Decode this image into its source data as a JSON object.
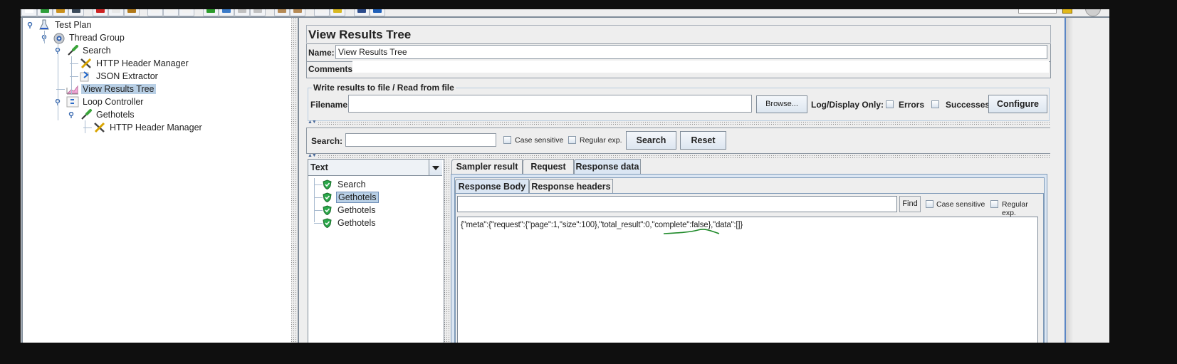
{
  "toolbar": {
    "buttons": [
      "new-icon",
      "templates-icon",
      "open-icon",
      "save-icon",
      "cut-icon",
      "copy-icon",
      "paste-icon",
      "expand-icon",
      "collapse-icon",
      "toggle-icon",
      "start-icon",
      "start-no-pauses-icon",
      "stop-icon",
      "shutdown-icon",
      "clear-icon",
      "clear-all-icon",
      "search-icon",
      "reset-search-icon",
      "function-helper-icon",
      "help-icon"
    ],
    "colors": [
      "#ffffff",
      "#2e9e3a",
      "#c98f1a",
      "#3a4a5a",
      "#cc2222",
      "#e8e8e8",
      "#b07818",
      "#f2f2f2",
      "#f2f2f2",
      "#f2f2f2",
      "#2a9a2a",
      "#3a7ac8",
      "#c0c0c0",
      "#c0c0c0",
      "#b58a55",
      "#b58a55",
      "#f2f2f2",
      "#d8b820",
      "#2a4a8a",
      "#1e5fb8"
    ]
  },
  "test_tree": {
    "items": [
      {
        "label": "Test Plan",
        "icon": "test-plan-flask-icon",
        "level": 0,
        "expandable": true
      },
      {
        "label": "Thread Group",
        "icon": "thread-group-gear-icon",
        "level": 1,
        "expandable": true
      },
      {
        "label": "Search",
        "icon": "http-sampler-pipette-icon",
        "level": 2,
        "expandable": true
      },
      {
        "label": "HTTP Header Manager",
        "icon": "config-tools-icon",
        "level": 3,
        "expandable": false
      },
      {
        "label": "JSON Extractor",
        "icon": "post-processor-arrow-icon",
        "level": 3,
        "expandable": false
      },
      {
        "label": "View Results Tree",
        "icon": "listener-chart-icon",
        "level": 2,
        "expandable": false,
        "selected": true
      },
      {
        "label": "Loop Controller",
        "icon": "loop-controller-icon",
        "level": 2,
        "expandable": true
      },
      {
        "label": "Gethotels",
        "icon": "http-sampler-pipette-icon",
        "level": 3,
        "expandable": true
      },
      {
        "label": "HTTP Header Manager",
        "icon": "config-tools-icon",
        "level": 4,
        "expandable": false
      }
    ]
  },
  "panel": {
    "title": "View Results Tree",
    "name_label": "Name:",
    "name_value": "View Results Tree",
    "comments_label": "Comments:",
    "comments_value": "",
    "file_group_title": "Write results to file / Read from file",
    "filename_label": "Filename",
    "filename_value": "",
    "browse_label": "Browse...",
    "log_display_label": "Log/Display Only:",
    "errors_label": "Errors",
    "errors_checked": false,
    "successes_label": "Successes",
    "successes_checked": false,
    "configure_label": "Configure"
  },
  "search": {
    "label": "Search:",
    "value": "",
    "case_sensitive_label": "Case sensitive",
    "case_sensitive_checked": false,
    "regex_label": "Regular exp.",
    "regex_checked": false,
    "search_button": "Search",
    "reset_button": "Reset"
  },
  "results": {
    "renderer": "Text",
    "samples": [
      {
        "label": "Search",
        "status": "success",
        "selected": false
      },
      {
        "label": "Gethotels",
        "status": "success",
        "selected": true
      },
      {
        "label": "Gethotels",
        "status": "success",
        "selected": false
      },
      {
        "label": "Gethotels",
        "status": "success",
        "selected": false
      }
    ]
  },
  "detail": {
    "tabs": [
      "Sampler result",
      "Request",
      "Response data"
    ],
    "active_tab": "Response data",
    "subtabs": [
      "Response Body",
      "Response headers"
    ],
    "active_subtab": "Response Body",
    "find_value": "",
    "find_button": "Find",
    "case_sensitive_label": "Case sensitive",
    "regex_label": "Regular exp.",
    "response_body": "{\"meta\":{\"request\":{\"page\":1,\"size\":100},\"total_result\":0,\"complete\":false},\"data\":[]}",
    "annotation_color": "#1f8a2a"
  },
  "colors": {
    "selection": "#b8cfe5",
    "border": "#7f8b98",
    "tab_active": "#dbe6f3",
    "success_green": "#2aa84a"
  }
}
